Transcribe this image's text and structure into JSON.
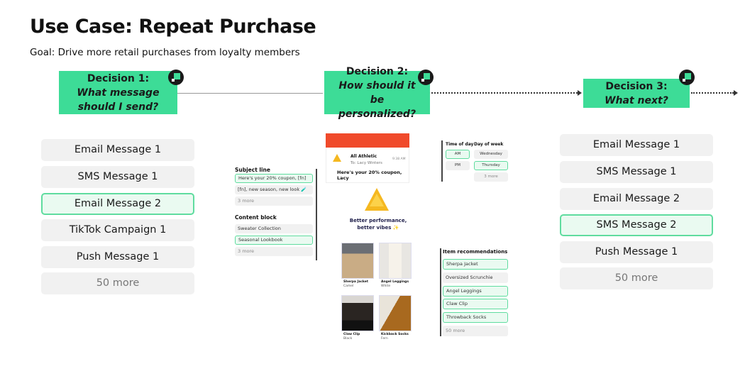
{
  "title": "Use Case: Repeat Purchase",
  "goal": "Goal: Drive more retail purchases from loyalty members",
  "decisions": [
    {
      "label": "Decision 1:",
      "question": "What message should I send?"
    },
    {
      "label": "Decision 2:",
      "question": "How should it be personalized?"
    },
    {
      "label": "Decision 3:",
      "question": "What next?"
    }
  ],
  "colors": {
    "accent": "#3ddc97",
    "email_header": "#f04a2b"
  },
  "decision1_options": [
    "Email Message 1",
    "SMS Message 1",
    "Email Message 2",
    "TikTok Campaign 1",
    "Push Message 1",
    "50 more"
  ],
  "decision3_options": [
    "Email Message 1",
    "SMS Message 1",
    "Email Message 2",
    "SMS Message 2",
    "Push Message 1",
    "50 more"
  ],
  "subject_line": {
    "header": "Subject line",
    "options": [
      "Here's your 20% coupon, [fn]",
      "[fn], new season, new look 🧪",
      "3 more"
    ]
  },
  "content_block": {
    "header": "Content block",
    "options": [
      "Sweater Collection",
      "Seasonal Lookbook",
      "3 more"
    ]
  },
  "email_preview": {
    "sender": "All Athletic",
    "to": "To: Lacy Winters",
    "time": "9:38 AM",
    "subject": "Here's your 20% coupon, Lacy",
    "tagline": "Better performance, better vibes ✨",
    "products": [
      {
        "name": "Sherpa Jacket",
        "variant": "Camel"
      },
      {
        "name": "Angel Leggings",
        "variant": "White"
      },
      {
        "name": "Claw Clip",
        "variant": "Black"
      },
      {
        "name": "Kickback Socks",
        "variant": "Fern"
      }
    ]
  },
  "time_of_day": {
    "header": "Time of day",
    "options": [
      "AM",
      "PM"
    ]
  },
  "day_of_week": {
    "header": "Day of week",
    "options": [
      "Wednesday",
      "Thursday",
      "3 more"
    ]
  },
  "item_recommendations": {
    "header": "Item recommendations",
    "options": [
      "Sherpa Jacket",
      "Oversized Scrunchie",
      "Angel Leggings",
      "Claw Clip",
      "Throwback Socks",
      "50 more"
    ]
  }
}
